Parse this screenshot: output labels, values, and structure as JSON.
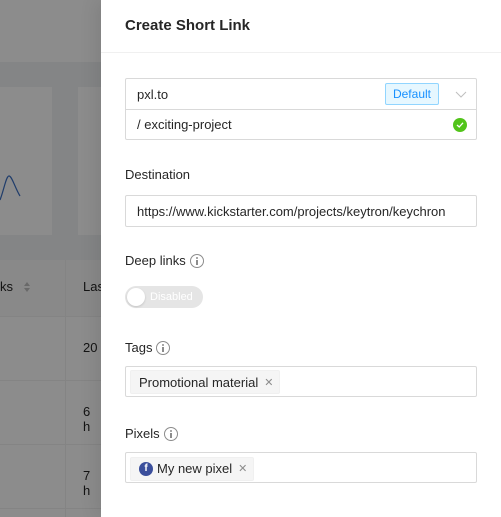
{
  "background": {
    "table": {
      "headers": [
        "Clicks (partial: \"ks\")",
        "Last (partial: \"Las\")"
      ],
      "header_clicks_visible": "ks",
      "header_last_visible": "Las",
      "rows": [
        {
          "last_visible": "20"
        },
        {
          "last_visible": "6 h"
        },
        {
          "last_visible": "7 h"
        }
      ]
    },
    "chart_line_color": "#3b6fc4"
  },
  "drawer": {
    "title": "Create Short Link",
    "domain": {
      "value": "pxl.to",
      "badge": "Default",
      "dropdown_icon": "chevron-down-icon"
    },
    "slug": {
      "value": "/ exciting-project",
      "status_icon": "check-circle-icon",
      "status_color": "#52c41a"
    },
    "destination": {
      "label": "Destination",
      "value": "https://www.kickstarter.com/projects/keytron/keychron"
    },
    "deep_links": {
      "label": "Deep links",
      "info_icon": "info-circle-icon",
      "toggle_label": "Disabled",
      "toggle_on": false
    },
    "tags": {
      "label": "Tags",
      "info_icon": "info-circle-icon",
      "items": [
        {
          "label": "Promotional material",
          "close_icon": "close-icon"
        }
      ]
    },
    "pixels": {
      "label": "Pixels",
      "info_icon": "info-circle-icon",
      "items": [
        {
          "label": "My new pixel",
          "icon": "facebook-icon",
          "close_icon": "close-icon"
        }
      ]
    }
  }
}
